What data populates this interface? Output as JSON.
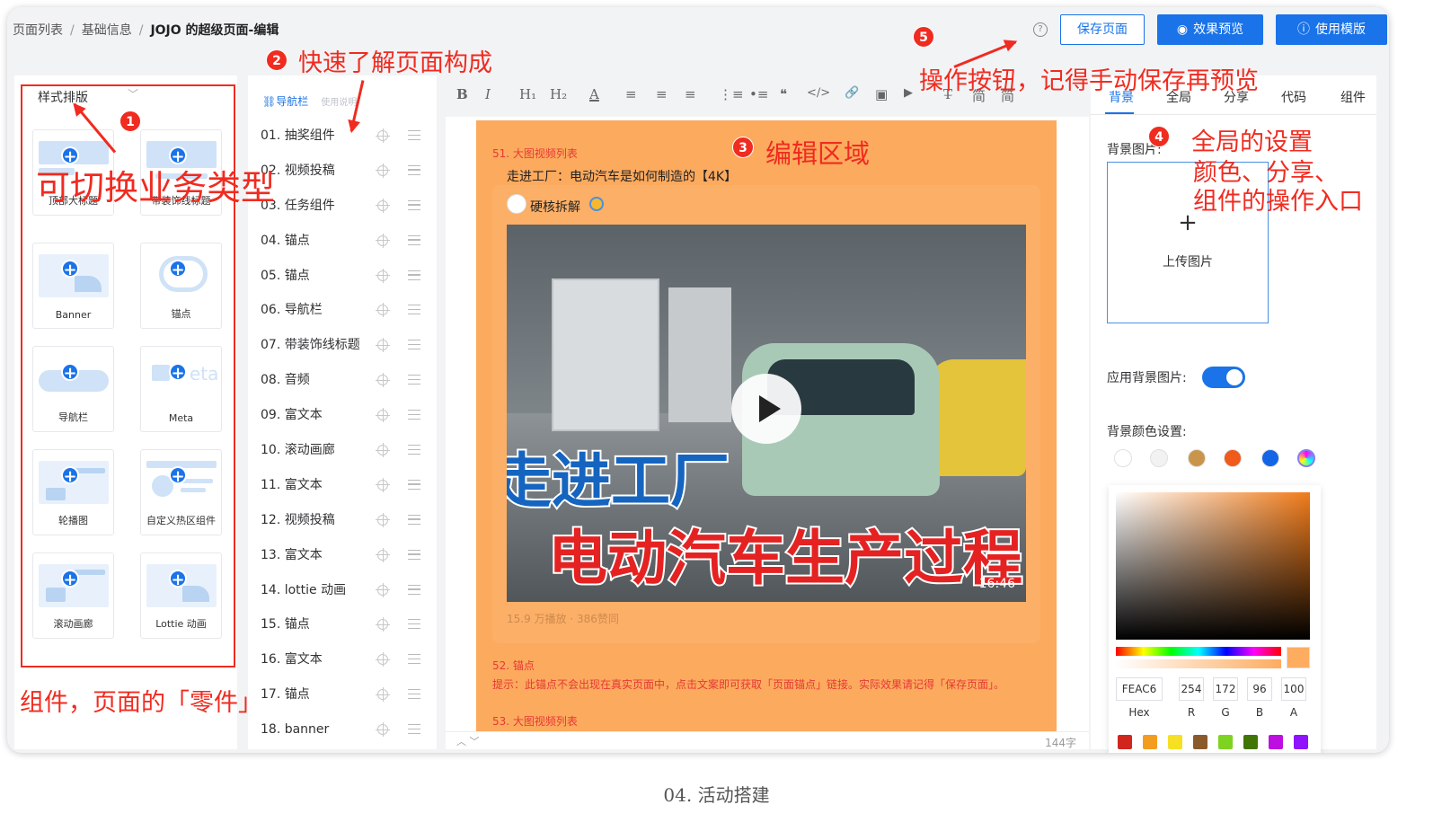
{
  "breadcrumb": {
    "items": [
      "页面列表",
      "基础信息",
      "JOJO 的超级页面-编辑"
    ],
    "separator": "/"
  },
  "header": {
    "save_label": "保存页面",
    "preview_label": "效果预览",
    "template_label": "使用模版",
    "help_icon": "?"
  },
  "left_panel": {
    "selector_label": "样式排版",
    "components": [
      "顶部大标题",
      "带装饰线标题",
      "Banner",
      "锚点",
      "导航栏",
      "Meta",
      "轮播图",
      "自定义热区组件",
      "滚动画廊",
      "Lottie 动画"
    ]
  },
  "mid_panel": {
    "tab_active": "导航栏",
    "tab_other": "使用说明",
    "items": [
      "01. 抽奖组件",
      "02. 视频投稿",
      "03. 任务组件",
      "04. 锚点",
      "05. 锚点",
      "06. 导航栏",
      "07. 带装饰线标题",
      "08. 音频",
      "09. 富文本",
      "10. 滚动画廊",
      "11. 富文本",
      "12. 视频投稿",
      "13. 富文本",
      "14. lottie 动画",
      "15. 锚点",
      "16. 富文本",
      "17. 锚点",
      "18. banner"
    ]
  },
  "editor": {
    "toolbar": [
      "B",
      "I",
      "H₁",
      "H₂",
      "A",
      "≡",
      "≡",
      "≡",
      "⋮≡",
      "•≡",
      "❝",
      "</>",
      "🔗",
      "▣",
      "▶",
      "T̶",
      "简",
      "简"
    ],
    "block_label_51": "51. 大图视频列表",
    "video_title": "走进工厂：电动汽车是如何制造的【4K】",
    "author": "硬核拆解",
    "overlay_line1": "走进工厂",
    "overlay_line2": "电动汽车生产过程",
    "duration": "16:46",
    "stats": "15.9 万播放 · 386赞同",
    "anchor_label": "52. 锚点",
    "tip": "提示：此锚点不会出现在真实页面中，点击文案即可获取「页面锚点」链接。实际效果请记得「保存页面」。",
    "block_label_53": "53. 大图视频列表",
    "word_count": "144字"
  },
  "right_panel": {
    "tabs": [
      "背景",
      "全局",
      "分享",
      "代码",
      "组件"
    ],
    "bg_image_label": "背景图片:",
    "upload_plus": "+",
    "upload_text": "上传图片",
    "apply_bg_label": "应用背景图片:",
    "bg_color_label": "背景颜色设置:",
    "swatches": [
      "#ffffff",
      "#f2f2f2",
      "#c9954a",
      "#f05a1a",
      "#1464e6",
      "#8a7cf0"
    ],
    "picker": {
      "hex": "FEAC6",
      "r": "254",
      "g": "172",
      "b": "96",
      "a": "100",
      "hex_label": "Hex",
      "r_label": "R",
      "g_label": "G",
      "b_label": "B",
      "a_label": "A"
    },
    "presets": [
      "#d0261e",
      "#f39c1f",
      "#f5e023",
      "#8b5a2b",
      "#7ed321",
      "#417505",
      "#bd10e0",
      "#9013fe"
    ]
  },
  "annotations": {
    "n1": "1",
    "t1": "可切换业务类型",
    "n2": "2",
    "t2": "快速了解页面构成",
    "n3": "3",
    "t3": "编辑区域",
    "n4": "4",
    "t4a": "全局的设置",
    "t4b": "颜色、分享、",
    "t4c": "组件的操作入口",
    "n5": "5",
    "t5": "操作按钮，记得手动保存再预览",
    "t6": "组件，页面的「零件」"
  },
  "caption": "04. 活动搭建"
}
